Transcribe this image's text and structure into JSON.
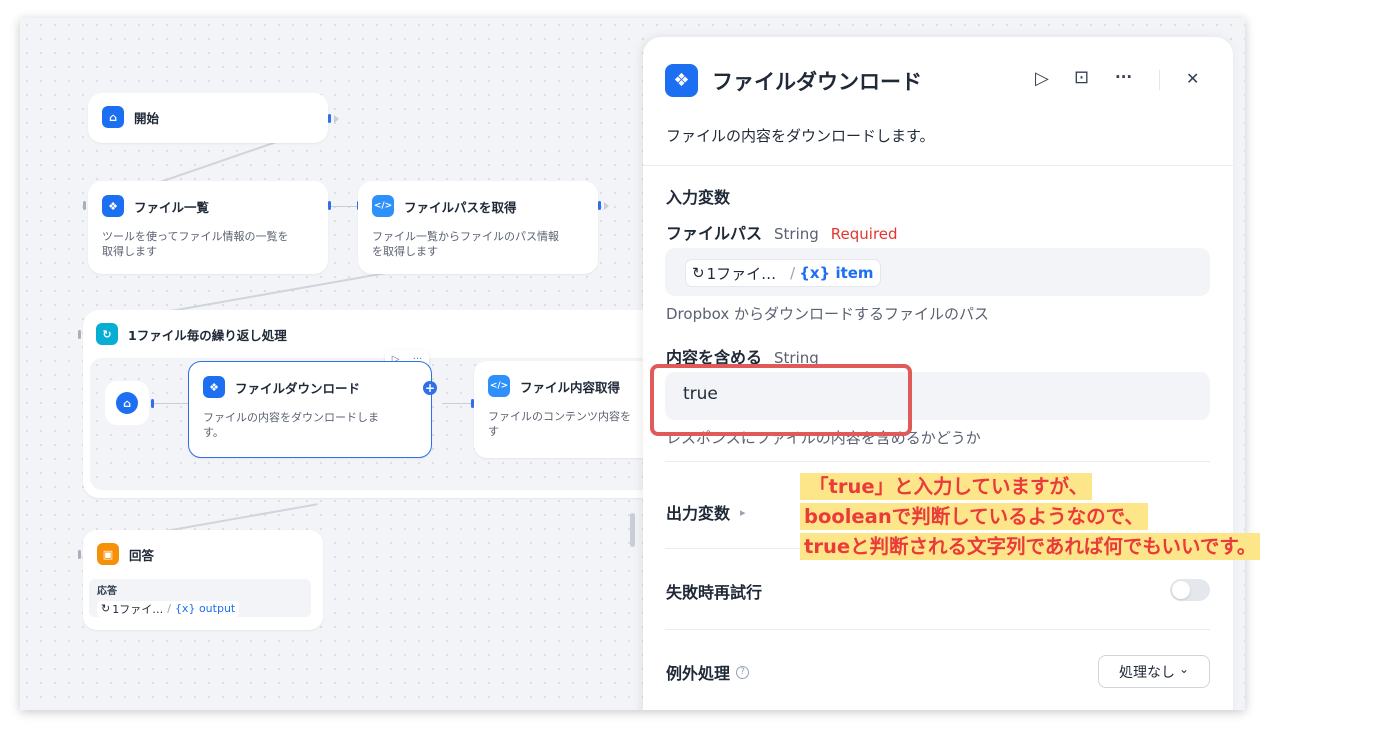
{
  "canvas": {
    "start_node": {
      "title": "開始"
    },
    "file_list_node": {
      "title": "ファイル一覧",
      "desc_line1": "ツールを使ってファイル情報の一覧を",
      "desc_line2": "取得します"
    },
    "file_path_node": {
      "title": "ファイルパスを取得",
      "desc_line1": "ファイル一覧からファイルのパス情報",
      "desc_line2": "を取得します"
    },
    "loop_group": {
      "title": "1ファイル毎の繰り返し処理",
      "toolbar_play": "▷",
      "toolbar_more": "···",
      "download_node": {
        "title": "ファイルダウンロード",
        "desc_line1": "ファイルの内容をダウンロードしま",
        "desc_line2": "す。"
      },
      "content_node": {
        "title": "ファイル内容取得",
        "desc_line1": "ファイルのコンテンツ内容を",
        "desc_line2": "す"
      }
    },
    "answer_node": {
      "title": "回答",
      "field_label": "応答",
      "chip_source": "1ファイ…",
      "chip_sep": "/",
      "chip_var": "{x} output"
    }
  },
  "panel": {
    "title": "ファイルダウンロード",
    "description": "ファイルの内容をダウンロードします。",
    "header_actions": {
      "run": "▷",
      "docs": "⊡",
      "more": "···",
      "close": "✕"
    },
    "input_section_title": "入力変数",
    "file_path": {
      "label": "ファイルパス",
      "type": "String",
      "required": "Required",
      "chip_source": "1ファイ…",
      "chip_sep": "/",
      "chip_var": "{x} item",
      "hint": "Dropbox からダウンロードするファイルのパス"
    },
    "include_content": {
      "label": "内容を含める",
      "type": "String",
      "value": "true",
      "hint": "レスポンスにファイルの内容を含めるかどうか"
    },
    "output_section": {
      "label": "出力変数",
      "caret": "▸"
    },
    "retry": {
      "label": "失敗時再試行",
      "enabled": false
    },
    "exception": {
      "label": "例外処理",
      "help": "?",
      "select_value": "処理なし",
      "select_caret": "⌄"
    }
  },
  "annotation": {
    "line1": "「true」と入力していますが、",
    "line2": "booleanで判断しているようなので、",
    "line3": "trueと判断される文字列であれば何でもいいです。"
  },
  "colors": {
    "accent": "#1d6ff2",
    "highlight_box": "#e05a5a",
    "annotation_bg": "#fde68a",
    "annotation_text": "#ea3a3a",
    "required": "#e5342f"
  }
}
